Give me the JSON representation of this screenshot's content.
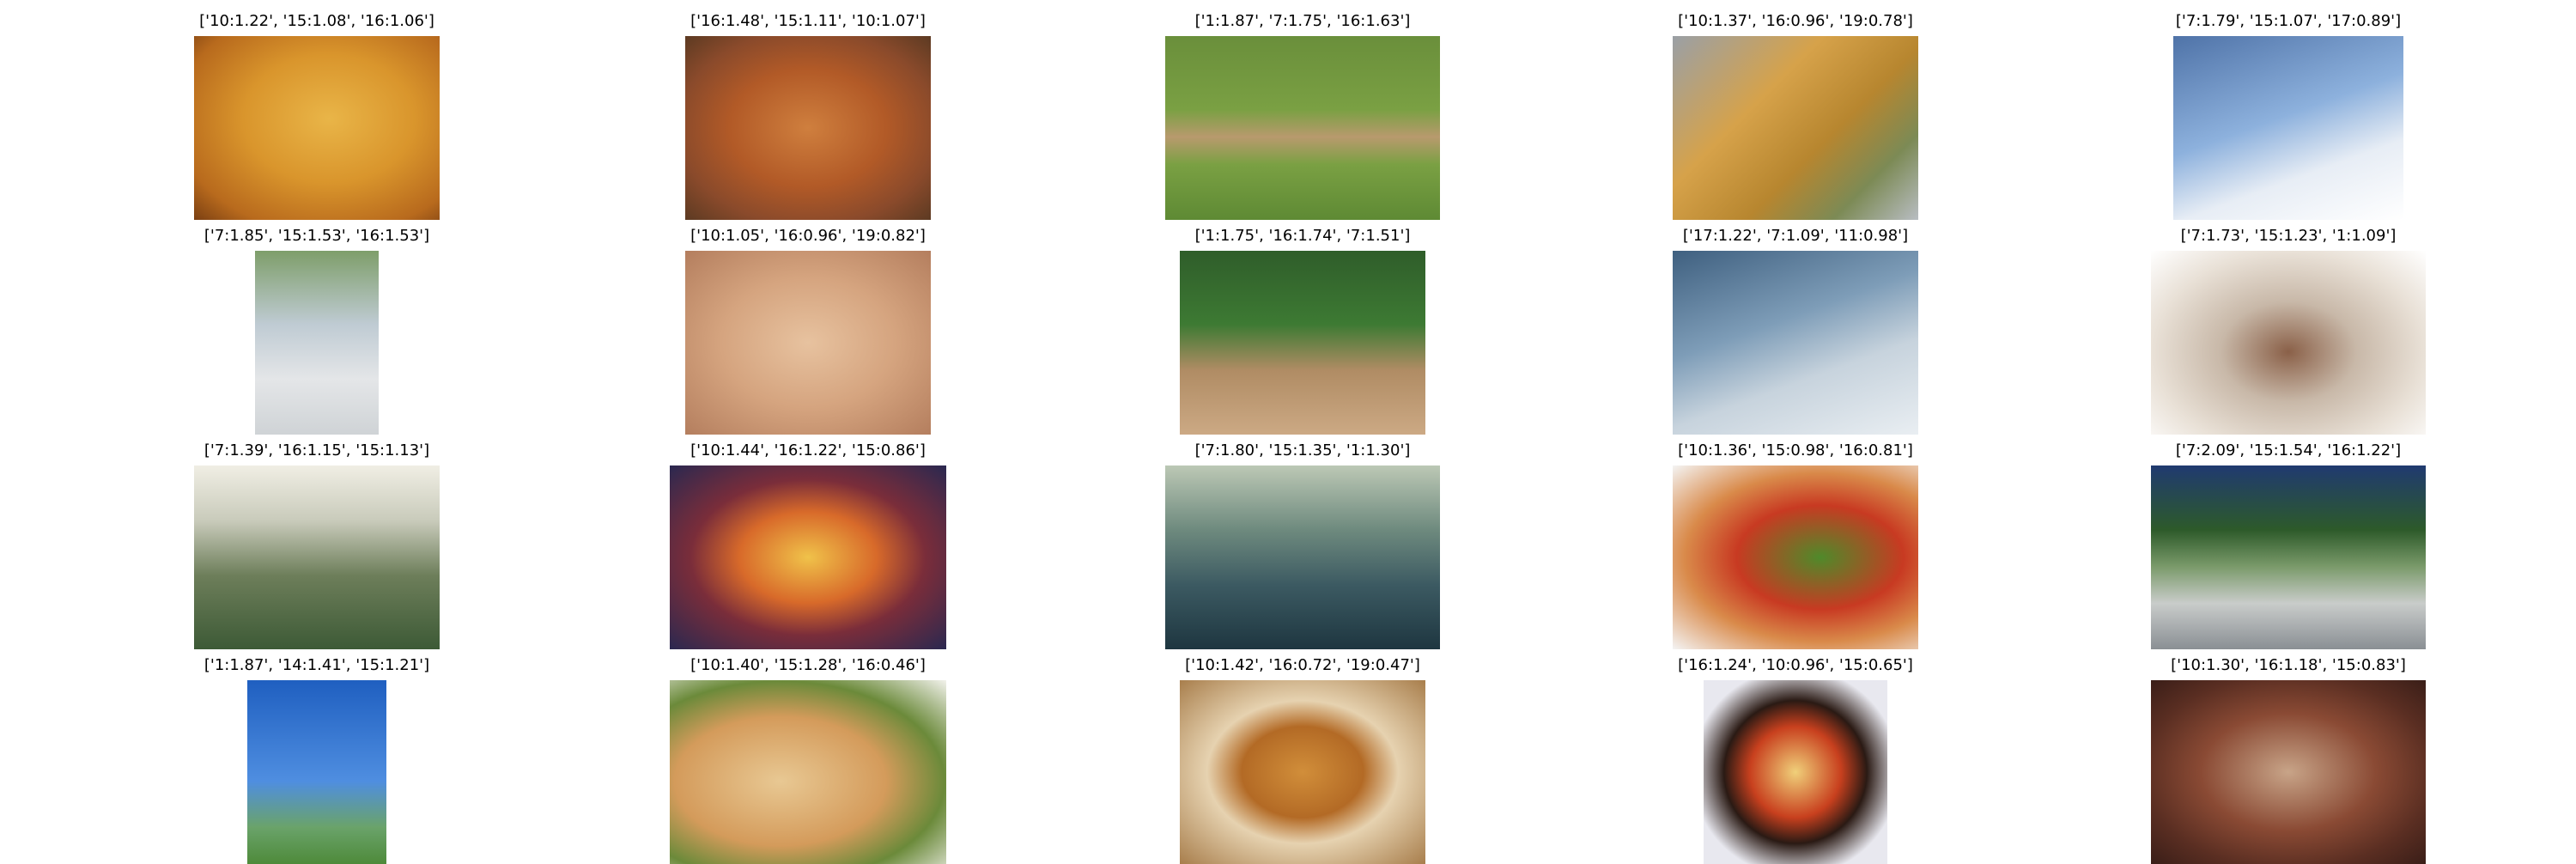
{
  "images": [
    {
      "title": "['10:1.22', '15:1.08', '16:1.06']",
      "icon": "pizza-photo"
    },
    {
      "title": "['16:1.48', '15:1.11', '10:1.07']",
      "icon": "pizza-photo"
    },
    {
      "title": "['1:1.87', '7:1.75', '16:1.63']",
      "icon": "baseball-photo"
    },
    {
      "title": "['10:1.37', '16:0.96', '19:0.78']",
      "icon": "pizza-photo"
    },
    {
      "title": "['7:1.79', '15:1.07', '17:0.89']",
      "icon": "ski-photo"
    },
    {
      "title": "['7:1.85', '15:1.53', '16:1.53']",
      "icon": "skateboard-photo"
    },
    {
      "title": "['10:1.05', '16:0.96', '19:0.82']",
      "icon": "pizza-photo"
    },
    {
      "title": "['1:1.75', '16:1.74', '7:1.51']",
      "icon": "baseball-photo"
    },
    {
      "title": "['17:1.22', '7:1.09', '11:0.98']",
      "icon": "ski-photo"
    },
    {
      "title": "['7:1.73', '15:1.23', '1:1.09']",
      "icon": "surf-photo"
    },
    {
      "title": "['7:1.39', '16:1.15', '15:1.13']",
      "icon": "surf-photo"
    },
    {
      "title": "['10:1.44', '16:1.22', '15:0.86']",
      "icon": "pizza-photo"
    },
    {
      "title": "['7:1.80', '15:1.35', '1:1.30']",
      "icon": "surf-photo"
    },
    {
      "title": "['10:1.36', '15:0.98', '16:0.81']",
      "icon": "pizza-photo"
    },
    {
      "title": "['7:2.09', '15:1.54', '16:1.22']",
      "icon": "skateboard-photo"
    },
    {
      "title": "['1:1.87', '14:1.41', '15:1.21']",
      "icon": "frisbee-photo"
    },
    {
      "title": "['10:1.40', '15:1.28', '16:0.46']",
      "icon": "pizza-photo"
    },
    {
      "title": "['10:1.42', '16:0.72', '19:0.47']",
      "icon": "pizza-photo"
    },
    {
      "title": "['16:1.24', '10:0.96', '15:0.65']",
      "icon": "pizza-photo"
    },
    {
      "title": "['10:1.30', '16:1.18', '15:0.83']",
      "icon": "pizza-photo"
    }
  ]
}
